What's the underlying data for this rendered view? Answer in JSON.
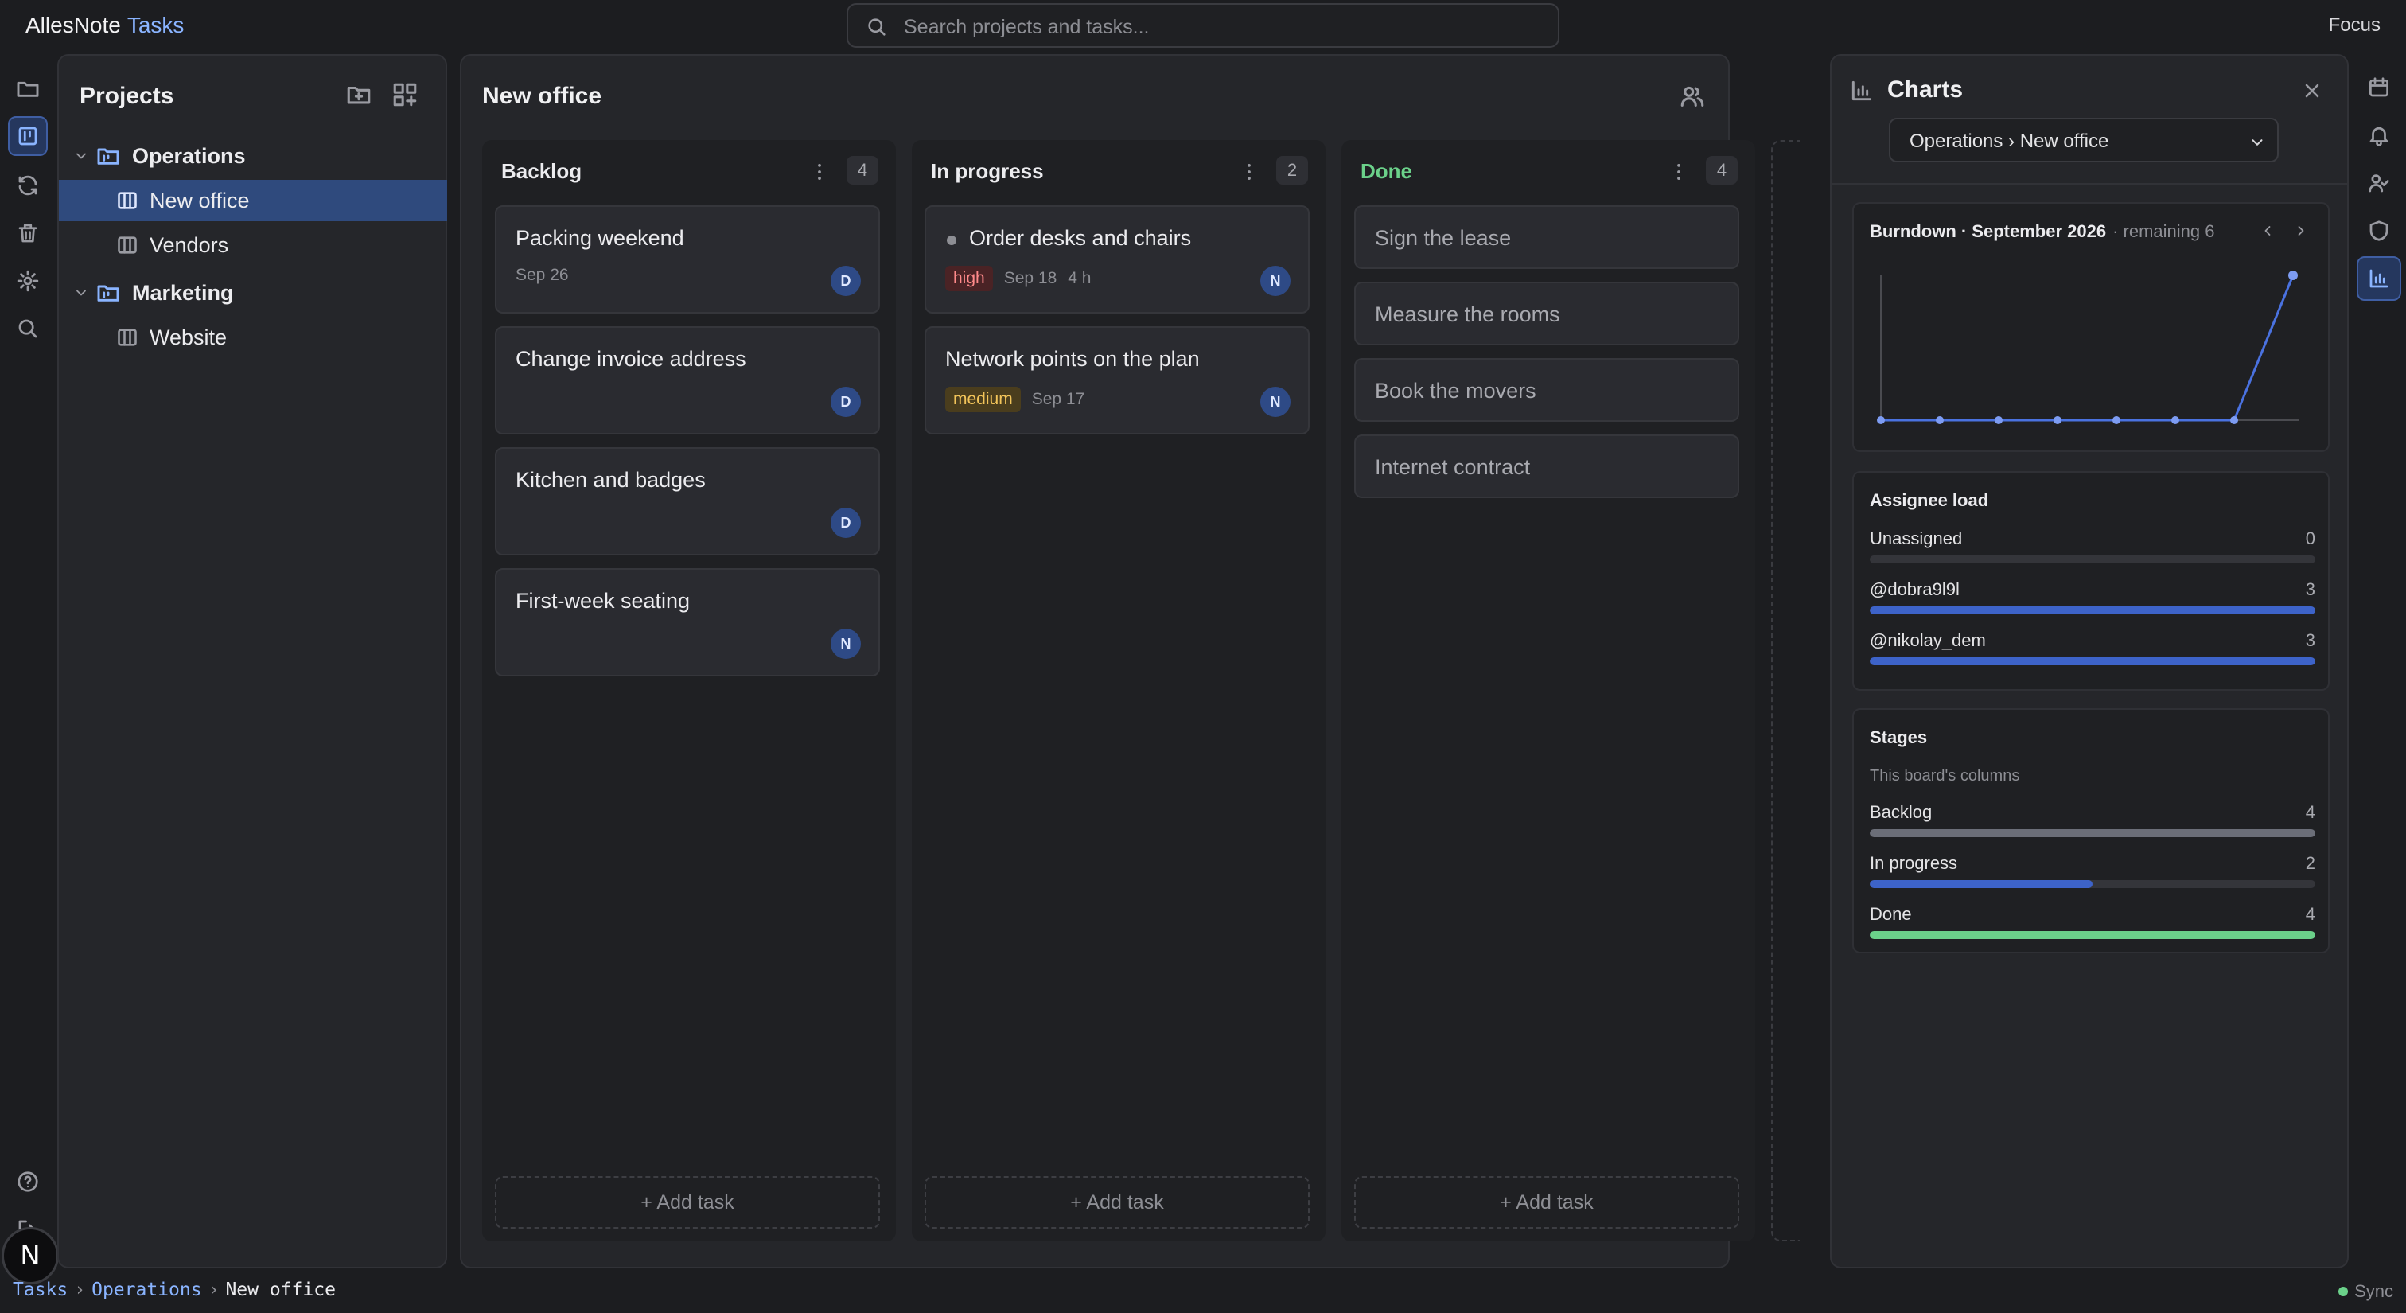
{
  "app": {
    "name": "AllesNote",
    "section": "Tasks",
    "focus_label": "Focus"
  },
  "search": {
    "placeholder": "Search projects and tasks..."
  },
  "projects": {
    "title": "Projects",
    "tree": [
      {
        "label": "Operations",
        "type": "folder"
      },
      {
        "label": "New office",
        "type": "board",
        "selected": true
      },
      {
        "label": "Vendors",
        "type": "board"
      },
      {
        "label": "Marketing",
        "type": "folder"
      },
      {
        "label": "Website",
        "type": "board"
      }
    ]
  },
  "board": {
    "title": "New office",
    "add_task_label": "+ Add task",
    "columns": [
      {
        "name": "Backlog",
        "count": "4",
        "cards": [
          {
            "title": "Packing weekend",
            "date": "Sep 26",
            "assignee": "D"
          },
          {
            "title": "Change invoice address",
            "assignee": "D"
          },
          {
            "title": "Kitchen and badges",
            "assignee": "D"
          },
          {
            "title": "First-week seating",
            "assignee": "N"
          }
        ]
      },
      {
        "name": "In progress",
        "count": "2",
        "cards": [
          {
            "title": "Order desks and chairs",
            "priority": "high",
            "date": "Sep 18",
            "estimate": "4 h",
            "assignee": "N"
          },
          {
            "title": "Network points on the plan",
            "priority": "medium",
            "date": "Sep 17",
            "assignee": "N"
          }
        ]
      },
      {
        "name": "Done",
        "count": "4",
        "cards": [
          {
            "title": "Sign the lease"
          },
          {
            "title": "Measure the rooms"
          },
          {
            "title": "Book the movers"
          },
          {
            "title": "Internet contract"
          }
        ]
      }
    ]
  },
  "charts": {
    "title": "Charts",
    "selector": "Operations › New office",
    "burndown": {
      "title": "Burndown · September 2026",
      "remaining": "· remaining 6",
      "chart_data": {
        "type": "line",
        "x": [
          1,
          2,
          3,
          4,
          5,
          6,
          7,
          8
        ],
        "values": [
          0,
          0,
          0,
          0,
          0,
          0,
          0,
          6
        ],
        "ylim": [
          0,
          6
        ],
        "grid": false
      }
    },
    "assignee_load": {
      "title": "Assignee load",
      "rows": [
        {
          "label": "Unassigned",
          "value": "0",
          "fraction": 0
        },
        {
          "label": "@dobra9l9l",
          "value": "3",
          "fraction": 1
        },
        {
          "label": "@nikolay_dem",
          "value": "3",
          "fraction": 1
        }
      ]
    },
    "stages": {
      "title": "Stages",
      "desc": "This board's columns",
      "rows": [
        {
          "label": "Backlog",
          "value": "4",
          "fraction": 1,
          "color": "#6b6e78"
        },
        {
          "label": "In progress",
          "value": "2",
          "fraction": 0.5,
          "color": "#3d63c9"
        },
        {
          "label": "Done",
          "value": "4",
          "fraction": 1,
          "color": "#6bd18a"
        }
      ]
    }
  },
  "breadcrumb": [
    "Tasks",
    "Operations",
    "New office"
  ],
  "status": {
    "sync": "Sync"
  },
  "user": {
    "initial": "N"
  },
  "colors": {
    "accent": "#3d63c9",
    "done": "#6bd18a"
  }
}
